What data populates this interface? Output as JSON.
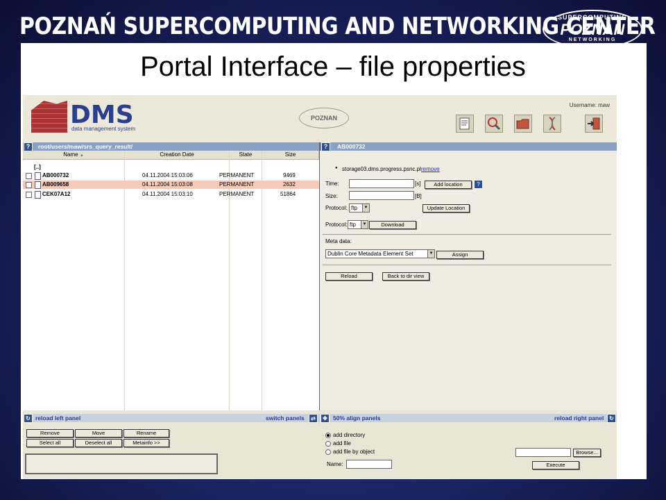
{
  "banner": {
    "title": "POZNAŃ SUPERCOMPUTING AND NETWORKING CENTER",
    "logo_top": "SUPERCOMPUTING",
    "logo_main": "POZNAN",
    "logo_bottom": "NETWORKING"
  },
  "slide": {
    "title": "Portal Interface – file properties"
  },
  "app": {
    "logo_text": "DMS",
    "logo_sub": "data management system",
    "center_logo": "POZNAN",
    "username": "Username: maw",
    "toolbar": [
      {
        "name": "properties-icon"
      },
      {
        "name": "search-icon"
      },
      {
        "name": "folder-icon"
      },
      {
        "name": "dna-icon"
      },
      {
        "name": "logout-icon"
      }
    ]
  },
  "left_panel": {
    "path": "root/users/maw/srs_query_result/",
    "columns": [
      "Name",
      "Creation Date",
      "State",
      "Size"
    ],
    "sort_mark": "▲",
    "parent_dir": "[..]",
    "rows": [
      {
        "name": "AB000732",
        "date": "04.11.2004 15:03:06",
        "state": "PERMANENT",
        "size": "9469",
        "selected": false
      },
      {
        "name": "AB009658",
        "date": "04.11.2004 15:03:08",
        "state": "PERMANENT",
        "size": "2632",
        "selected": true
      },
      {
        "name": "CEK07A12",
        "date": "04.11.2004 15:03:10",
        "state": "PERMANENT",
        "size": "51864",
        "selected": false
      }
    ]
  },
  "right_panel": {
    "title": "AB000732",
    "location": "storage03.dms.progress.psnc.pl",
    "remove_link": "remove",
    "time_label": "Time:",
    "time_unit": "[s]",
    "size_label": "Size:",
    "size_unit": "[B]",
    "add_location": "Add location",
    "protocol_label": "Protocol:",
    "protocol_value": "ftp",
    "update_location": "Update Location",
    "protocol2_label": "Protocol:",
    "protocol2_value": "ftp",
    "download": "Download",
    "meta_label": "Meta data:",
    "meta_value": "Dublin Core Metadata Element Set",
    "assign": "Assign",
    "reload": "Reload",
    "back": "Back to dir view"
  },
  "bottom": {
    "reload_left": "reload left panel",
    "switch_panels": "switch panels",
    "align": "50% align panels",
    "reload_right": "reload right panel",
    "buttons_row1": [
      "Remove",
      "Move",
      "Rename"
    ],
    "buttons_row2": [
      "Select all",
      "Deselect all",
      "Metainfo >>"
    ],
    "radio_options": [
      "add directory",
      "add file",
      "add file by object"
    ],
    "browse": "Browse...",
    "name_label": "Name:",
    "execute": "Execute"
  }
}
